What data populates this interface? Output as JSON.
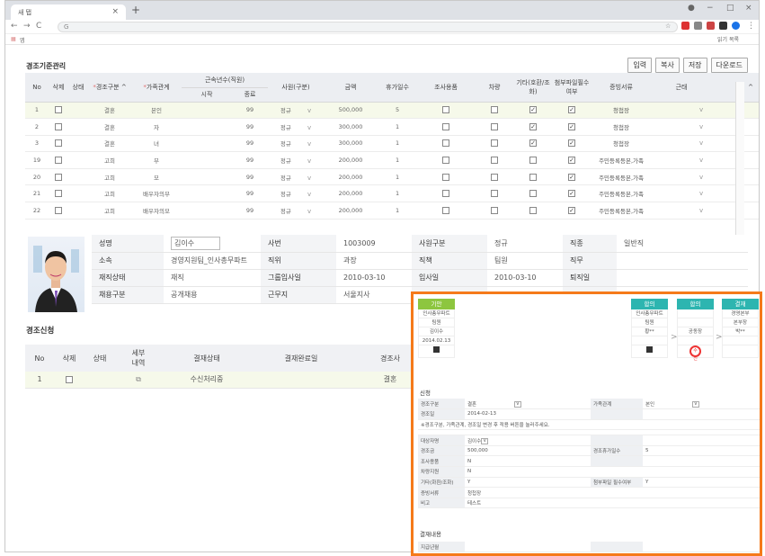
{
  "browser": {
    "tab_title": "새 탭",
    "address": "G",
    "bookmark_apps": "앱",
    "reading_list": "읽기 목록"
  },
  "page": {
    "title": "경조기준관리",
    "buttons": [
      "입력",
      "복사",
      "저장",
      "다운로드"
    ]
  },
  "grid": {
    "headers": {
      "no": "No",
      "del": "삭제",
      "state": "상태",
      "type": "경조구분",
      "rel": "가족관계",
      "years": "근속년수(직원)",
      "start": "시작",
      "end": "종료",
      "emp": "사원(구분)",
      "amount": "금액",
      "leave": "휴가일수",
      "flower": "조사용품",
      "car": "차량",
      "etc": "기타(호환/조화)",
      "attach": "첨부파일필수여부",
      "docs": "증빙서류",
      "rem": "근태"
    },
    "rows": [
      {
        "no": "1",
        "type": "결혼",
        "rel": "본인",
        "end": "99",
        "emp": "정규",
        "amount": "500,000",
        "leave": "5",
        "etc": true,
        "attach": true,
        "docs": "청첩장"
      },
      {
        "no": "2",
        "type": "결혼",
        "rel": "자",
        "end": "99",
        "emp": "정규",
        "amount": "300,000",
        "leave": "1",
        "etc": true,
        "attach": true,
        "docs": "청첩장"
      },
      {
        "no": "3",
        "type": "결혼",
        "rel": "녀",
        "end": "99",
        "emp": "정규",
        "amount": "300,000",
        "leave": "1",
        "etc": true,
        "attach": true,
        "docs": "청첩장"
      },
      {
        "no": "19",
        "type": "고희",
        "rel": "부",
        "end": "99",
        "emp": "정규",
        "amount": "200,000",
        "leave": "1",
        "etc": false,
        "attach": true,
        "docs": "주민등록등본,가족"
      },
      {
        "no": "20",
        "type": "고희",
        "rel": "모",
        "end": "99",
        "emp": "정규",
        "amount": "200,000",
        "leave": "1",
        "etc": false,
        "attach": true,
        "docs": "주민등록등본,가족"
      },
      {
        "no": "21",
        "type": "고희",
        "rel": "배우자의부",
        "end": "99",
        "emp": "정규",
        "amount": "200,000",
        "leave": "1",
        "etc": false,
        "attach": true,
        "docs": "주민등록등본,가족"
      },
      {
        "no": "22",
        "type": "고희",
        "rel": "배우자의모",
        "end": "99",
        "emp": "정규",
        "amount": "200,000",
        "leave": "1",
        "etc": false,
        "attach": true,
        "docs": "주민등록등본,가족"
      }
    ]
  },
  "profile": {
    "l_name": "성명",
    "name": "김이수",
    "l_empno": "사번",
    "empno": "1003009",
    "l_emptype": "사원구분",
    "emptype": "정규",
    "l_job": "직종",
    "job": "일반직",
    "l_dept": "소속",
    "dept": "경영지원팀_인사총무파트",
    "l_rank": "직위",
    "rank": "과장",
    "l_duty": "직책",
    "duty": "팀원",
    "l_task": "직무",
    "task": "",
    "l_status": "재직상태",
    "status": "재직",
    "l_gdate": "그룹입사일",
    "gdate": "2010-03-10",
    "l_jdate": "입사일",
    "jdate": "2010-03-10",
    "l_rdate": "퇴직일",
    "rdate": "",
    "l_hire": "채용구분",
    "hire": "공개채용",
    "l_place": "근무지",
    "place": "서울지사"
  },
  "apply": {
    "title": "경조신청",
    "h_no": "No",
    "h_del": "삭제",
    "h_state": "상태",
    "h_detail": "세부\n내역",
    "h_appr": "결재상태",
    "h_done": "결재완료일",
    "h_item": "경조사",
    "row_no": "1",
    "row_appr": "수신처리중",
    "row_item": "결혼"
  },
  "popup": {
    "a1": {
      "h": "기안",
      "c": [
        "인사총무파트",
        "팀원",
        "김이수",
        "2014.02.13"
      ]
    },
    "a2": {
      "h": "합의",
      "c": [
        "인사총무파트",
        "팀원",
        "황**"
      ]
    },
    "a3": {
      "h": "합의",
      "c": [
        "",
        "",
        "공동장"
      ]
    },
    "a4": {
      "h": "결재",
      "c": [
        "경영본부",
        "본부장",
        "박**"
      ]
    },
    "stamp": "수신",
    "s_apply": "신청",
    "l_type": "경조구분",
    "type": "결혼",
    "l_rel": "가족관계",
    "rel": "본인",
    "l_date": "경조일",
    "date": "2014-02-13",
    "note": "※경조구분, 가족관계, 경조일 변경 후 적용 버튼을 눌러주세요.",
    "l_target": "대상자명",
    "target": "김이수",
    "l_money": "경조금",
    "money": "500,000",
    "l_leave": "경조휴가일수",
    "leave": "5",
    "l_flower": "조사용품",
    "flower": "N",
    "l_car": "차량지원",
    "car": "N",
    "l_etc": "기타(화환/조화)",
    "etc": "Y",
    "l_attach": "첨부파일 필수여부",
    "attach": "Y",
    "l_docs": "증빙서류",
    "docs": "청첩장",
    "l_memo": "비고",
    "memo": "테스트",
    "s_pay": "결재내용",
    "l_payopinion": "지급년월"
  },
  "colors": {
    "approve": "#8dc63f",
    "agree": "#2db5b0",
    "final": "#2db5b0",
    "popup_border": "#f57a1a"
  }
}
